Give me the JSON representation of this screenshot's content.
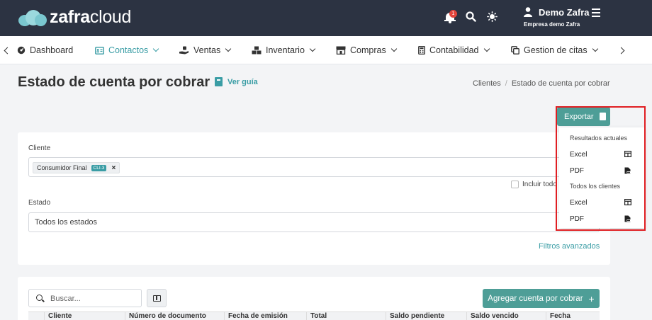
{
  "app": {
    "logo_bold": "zafra",
    "logo_light": "cloud",
    "notifications_count": "1",
    "user_name": "Demo Zafra",
    "company_name": "Empresa demo Zafra"
  },
  "nav": {
    "items": [
      {
        "label": "Dashboard",
        "icon": "gauge-icon"
      },
      {
        "label": "Contactos",
        "icon": "contacts-icon",
        "active": true
      },
      {
        "label": "Ventas",
        "icon": "hand-money-icon"
      },
      {
        "label": "Inventario",
        "icon": "boxes-icon"
      },
      {
        "label": "Compras",
        "icon": "store-icon"
      },
      {
        "label": "Contabilidad",
        "icon": "calculator-icon"
      },
      {
        "label": "Gestion de citas",
        "icon": "copy-icon"
      }
    ]
  },
  "page": {
    "title": "Estado de cuenta por cobrar",
    "guide_label": "Ver guía",
    "breadcrumb": [
      "Clientes",
      "Estado de cuenta por cobrar"
    ]
  },
  "export": {
    "button_label": "Exportar",
    "sections": [
      {
        "header": "Resultados actuales",
        "items": [
          "Excel",
          "PDF"
        ]
      },
      {
        "header": "Todos los clientes",
        "items": [
          "Excel",
          "PDF"
        ]
      }
    ]
  },
  "filters": {
    "client_label": "Cliente",
    "client_chip": "Consumidor Final",
    "client_code": "CLI-3",
    "include_all_label": "Incluir todo",
    "state_label": "Estado",
    "state_value": "Todos los estados",
    "advanced_label": "Filtros avanzados"
  },
  "table": {
    "search_placeholder": "Buscar...",
    "add_button": "Agregar cuenta por cobrar",
    "columns": [
      "Cliente",
      "Número de documento",
      "Fecha de emisión",
      "Total",
      "Saldo pendiente",
      "Saldo vencido",
      "Fecha"
    ]
  },
  "colors": {
    "topbar": "#2c3342",
    "accent": "#3a9da5",
    "button": "#4e9e97",
    "highlight": "#e01e22"
  }
}
